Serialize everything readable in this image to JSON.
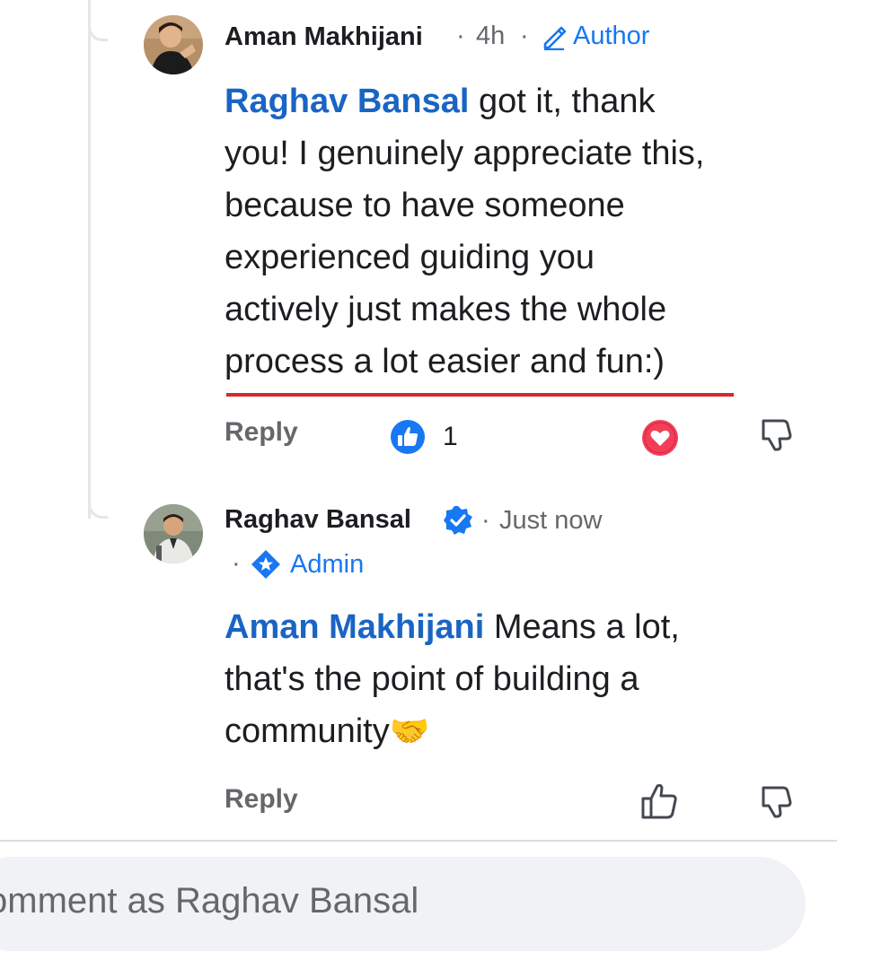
{
  "comments": [
    {
      "author": "Aman Makhijani",
      "separator1": "·",
      "time": "4h",
      "separator2": "·",
      "badge": "Author",
      "mention": "Raghav Bansal",
      "lines": [
        " got it, thank",
        "you! I genuinely appreciate this,",
        "because to have someone",
        "experienced guiding you",
        "actively just makes the whole",
        "process a lot easier and fun:)"
      ],
      "reply_label": "Reply",
      "like_count": "1",
      "reactions": [
        "like-icon",
        "love-icon"
      ]
    },
    {
      "author": "Raghav Bansal",
      "verified": true,
      "separator1": "·",
      "time": "Just now",
      "separator2": "·",
      "badge": "Admin",
      "mention": "Aman Makhijani",
      "lines": [
        " Means a lot,",
        "that's the point of building a",
        "community"
      ],
      "emoji": "🤝",
      "reply_label": "Reply"
    }
  ],
  "composer": {
    "placeholder": "omment as Raghav Bansal"
  },
  "colors": {
    "mention": "#1a64c4",
    "badge": "#1877f2",
    "underline": "#d42a2a",
    "love": "#f33e58"
  }
}
